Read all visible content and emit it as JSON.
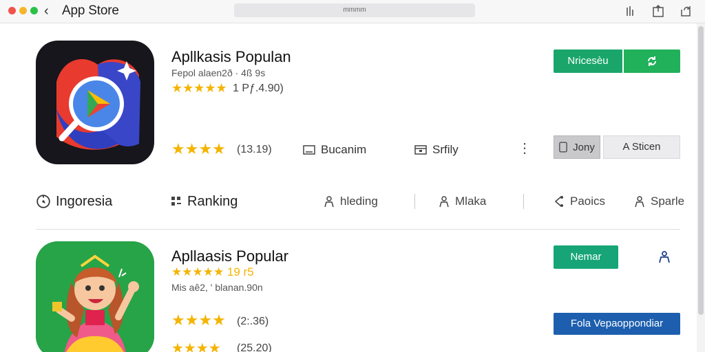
{
  "window": {
    "title": "App Store",
    "url": "mmmm"
  },
  "colors": {
    "accent_green": "#1aa66a",
    "accent_teal": "#17a577",
    "accent_blue": "#1d5fae",
    "star": "#f4b400"
  },
  "apps": [
    {
      "name": "Apllkasis Populan",
      "subtitle": "Fepol alaen2ð · 4ß 9s",
      "stars_top": "★★★★★",
      "rating_top": "1 Pƒ.4.90)",
      "stars_bottom": "★★★★",
      "rating_bottom": "(13.19)",
      "meta1": "Bucanim",
      "meta2": "Srfily",
      "primary_button": "Nricesèu",
      "secondary_button": "Jony",
      "tertiary_button": "A Sticen"
    },
    {
      "name": "Apllaasis Popular",
      "subtitle_top": "★★★★★  19 r5",
      "subtitle": "Mis aê2, ' blanan.90n",
      "stars_bottom": "★★★★",
      "rating_bottom": "(2:.36)",
      "stars_cut": "★★★★",
      "rating_cut": "(25.20)",
      "primary_button": "Nemar",
      "wide_button": "Fola Vepaoppondiar"
    }
  ],
  "categories": [
    {
      "label": "Ingoresia",
      "icon": "clock-icon"
    },
    {
      "label": "Ranking",
      "icon": "grid-icon"
    },
    {
      "label": "hleding",
      "icon": "person-icon"
    },
    {
      "label": "Mlaka",
      "icon": "person-icon"
    },
    {
      "label": "Paoics",
      "icon": "share-icon"
    },
    {
      "label": "Sparle",
      "icon": "person-icon"
    }
  ]
}
